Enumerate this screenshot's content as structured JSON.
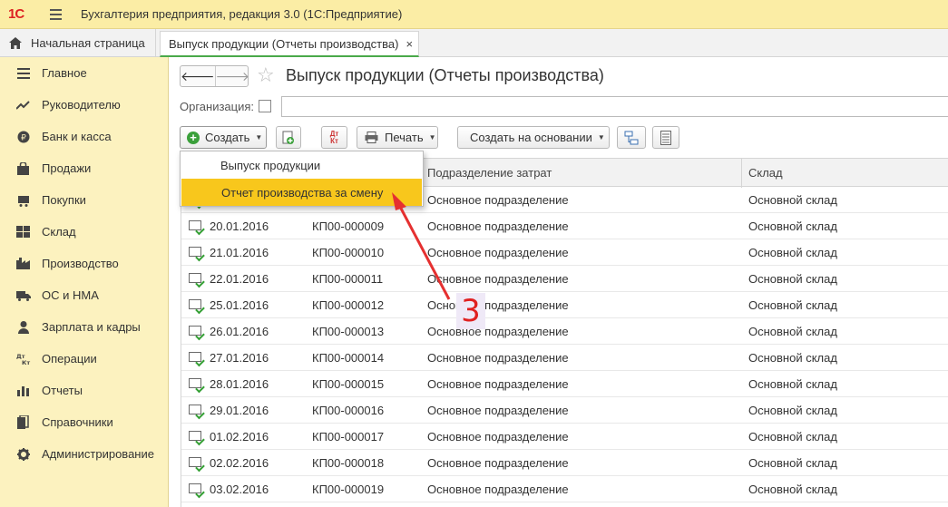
{
  "app": {
    "logo": "1С",
    "title": "Бухгалтерия предприятия, редакция 3.0  (1С:Предприятие)"
  },
  "tabs": {
    "home": "Начальная страница",
    "active": "Выпуск продукции (Отчеты производства)",
    "close": "×"
  },
  "sidebar": {
    "items": [
      {
        "label": "Главное",
        "icon": "menu-lines-icon"
      },
      {
        "label": "Руководителю",
        "icon": "trend-icon"
      },
      {
        "label": "Банк и касса",
        "icon": "coin-icon"
      },
      {
        "label": "Продажи",
        "icon": "bag-icon"
      },
      {
        "label": "Покупки",
        "icon": "cart-icon"
      },
      {
        "label": "Склад",
        "icon": "warehouse-icon"
      },
      {
        "label": "Производство",
        "icon": "factory-icon"
      },
      {
        "label": "ОС и НМА",
        "icon": "truck-icon"
      },
      {
        "label": "Зарплата и кадры",
        "icon": "person-icon"
      },
      {
        "label": "Операции",
        "icon": "dt-kt-icon"
      },
      {
        "label": "Отчеты",
        "icon": "bar-chart-icon"
      },
      {
        "label": "Справочники",
        "icon": "books-icon"
      },
      {
        "label": "Администрирование",
        "icon": "gear-icon"
      }
    ]
  },
  "page": {
    "title": "Выпуск продукции (Отчеты производства)",
    "back": "🡐",
    "forward": "🡒",
    "star": "☆"
  },
  "filter": {
    "org_label": "Организация:"
  },
  "toolbar": {
    "create": "Создать",
    "dt": "Дт",
    "kt": "Кт",
    "print": "Печать",
    "create_based": "Создать на основании"
  },
  "grid": {
    "columns": [
      "",
      "",
      "Подразделение затрат",
      "Склад"
    ],
    "rows": [
      {
        "date": "",
        "number": "",
        "dept": "Основное подразделение",
        "store": "Основной склад"
      },
      {
        "date": "20.01.2016",
        "number": "КП00-000009",
        "dept": "Основное подразделение",
        "store": "Основной склад"
      },
      {
        "date": "21.01.2016",
        "number": "КП00-000010",
        "dept": "Основное подразделение",
        "store": "Основной склад"
      },
      {
        "date": "22.01.2016",
        "number": "КП00-000011",
        "dept": "Основное подразделение",
        "store": "Основной склад"
      },
      {
        "date": "25.01.2016",
        "number": "КП00-000012",
        "dept": "Основное подразделение",
        "store": "Основной склад"
      },
      {
        "date": "26.01.2016",
        "number": "КП00-000013",
        "dept": "Основное подразделение",
        "store": "Основной склад"
      },
      {
        "date": "27.01.2016",
        "number": "КП00-000014",
        "dept": "Основное подразделение",
        "store": "Основной склад"
      },
      {
        "date": "28.01.2016",
        "number": "КП00-000015",
        "dept": "Основное подразделение",
        "store": "Основной склад"
      },
      {
        "date": "29.01.2016",
        "number": "КП00-000016",
        "dept": "Основное подразделение",
        "store": "Основной склад"
      },
      {
        "date": "01.02.2016",
        "number": "КП00-000017",
        "dept": "Основное подразделение",
        "store": "Основной склад"
      },
      {
        "date": "02.02.2016",
        "number": "КП00-000018",
        "dept": "Основное подразделение",
        "store": "Основной склад"
      },
      {
        "date": "03.02.2016",
        "number": "КП00-000019",
        "dept": "Основное подразделение",
        "store": "Основной склад"
      }
    ]
  },
  "dropdown": {
    "items": [
      "Выпуск продукции",
      "Отчет производства за смену"
    ],
    "selected": "Отчет производства за смену"
  },
  "annotation": {
    "badge": "3",
    "color": "#e53030"
  }
}
